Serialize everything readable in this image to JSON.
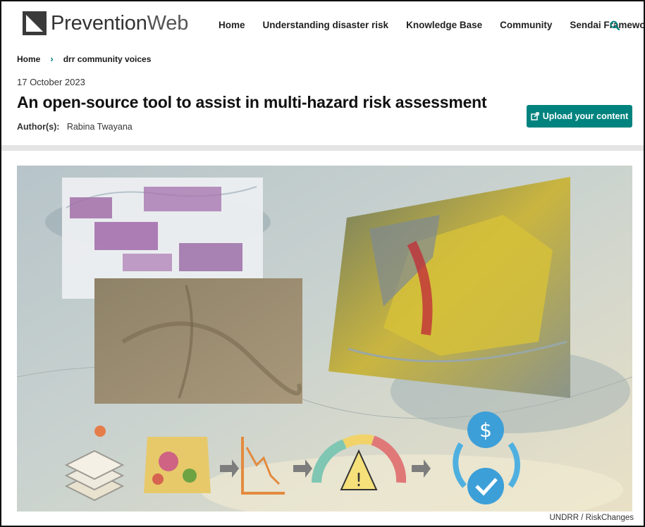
{
  "header": {
    "logo_main": "Prevention",
    "logo_sub": "Web",
    "nav": [
      "Home",
      "Understanding disaster risk",
      "Knowledge Base",
      "Community",
      "Sendai Framework"
    ]
  },
  "breadcrumb": {
    "home": "Home",
    "current": "drr community voices"
  },
  "article": {
    "date": "17 October 2023",
    "title": "An open-source tool to assist in multi-hazard risk assessment",
    "author_label": "Author(s):",
    "author": "Rabina Twayana",
    "upload_label": "Upload your content",
    "image_credit": "UNDRR / RiskChanges"
  },
  "colors": {
    "accent": "#00837e",
    "divider": "#e4e4e4"
  },
  "icons": [
    "prevention-web-logo",
    "search-icon",
    "upload-icon",
    "map-layers-icon",
    "map-icon",
    "loss-curve-icon",
    "risk-gauge-icon",
    "dollar-icon",
    "check-icon"
  ]
}
